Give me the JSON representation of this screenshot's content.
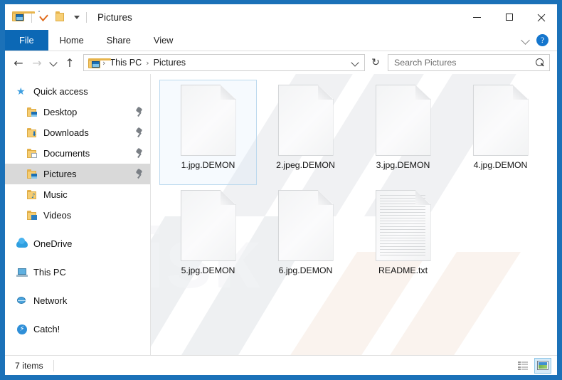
{
  "window": {
    "title": "Pictures",
    "quick_access_toolbar": [
      {
        "icon": "pictures-folder-icon",
        "name": "pictures-folder"
      },
      {
        "icon": "properties-icon",
        "name": "properties"
      },
      {
        "icon": "new-folder-icon",
        "name": "new-folder"
      },
      {
        "icon": "customize-caret-icon",
        "name": "customize-quick-access-toolbar"
      }
    ],
    "controls": {
      "minimize": "—",
      "maximize": "□",
      "close": "✕"
    }
  },
  "ribbon": {
    "tabs": [
      {
        "label": "File",
        "active": true
      },
      {
        "label": "Home",
        "active": false
      },
      {
        "label": "Share",
        "active": false
      },
      {
        "label": "View",
        "active": false
      }
    ],
    "help_label": "?"
  },
  "address_bar": {
    "back_glyph": "←",
    "forward_glyph": "→",
    "up_glyph": "↑",
    "refresh_glyph": "↻",
    "breadcrumbs": [
      "This PC",
      "Pictures"
    ],
    "separator": "›"
  },
  "search": {
    "placeholder": "Search Pictures",
    "value": ""
  },
  "sidebar": {
    "items": [
      {
        "label": "Quick access",
        "icon": "star-icon",
        "indent": false,
        "pinned": false,
        "selected": false
      },
      {
        "label": "Desktop",
        "icon": "desktop-folder-icon",
        "indent": true,
        "pinned": true,
        "selected": false
      },
      {
        "label": "Downloads",
        "icon": "downloads-folder-icon",
        "indent": true,
        "pinned": true,
        "selected": false
      },
      {
        "label": "Documents",
        "icon": "documents-folder-icon",
        "indent": true,
        "pinned": true,
        "selected": false
      },
      {
        "label": "Pictures",
        "icon": "pictures-folder-icon",
        "indent": true,
        "pinned": true,
        "selected": true
      },
      {
        "label": "Music",
        "icon": "music-folder-icon",
        "indent": true,
        "pinned": false,
        "selected": false
      },
      {
        "label": "Videos",
        "icon": "videos-folder-icon",
        "indent": true,
        "pinned": false,
        "selected": false
      },
      {
        "label": "OneDrive",
        "icon": "cloud-icon",
        "indent": false,
        "pinned": false,
        "selected": false
      },
      {
        "label": "This PC",
        "icon": "computer-icon",
        "indent": false,
        "pinned": false,
        "selected": false
      },
      {
        "label": "Network",
        "icon": "network-icon",
        "indent": false,
        "pinned": false,
        "selected": false
      },
      {
        "label": "Catch!",
        "icon": "catch-lightning-icon",
        "indent": false,
        "pinned": false,
        "selected": false
      }
    ]
  },
  "files": [
    {
      "name": "1.jpg.DEMON",
      "type": "blank-document",
      "selected": true
    },
    {
      "name": "2.jpeg.DEMON",
      "type": "blank-document",
      "selected": false
    },
    {
      "name": "3.jpg.DEMON",
      "type": "blank-document",
      "selected": false
    },
    {
      "name": "4.jpg.DEMON",
      "type": "blank-document",
      "selected": false
    },
    {
      "name": "5.jpg.DEMON",
      "type": "blank-document",
      "selected": false
    },
    {
      "name": "6.jpg.DEMON",
      "type": "blank-document",
      "selected": false
    },
    {
      "name": "README.txt",
      "type": "text-document",
      "selected": false
    }
  ],
  "status_bar": {
    "item_count": "7 items",
    "views": [
      {
        "name": "details-view",
        "active": false
      },
      {
        "name": "large-icons-view",
        "active": true
      }
    ]
  },
  "watermark": {
    "text": "pcrisk.com"
  },
  "colors": {
    "window_frame": "#1b71b8",
    "file_tab": "#0c68b5",
    "selection": "#d9d9d9",
    "tile_selection_border": "#bcd9ee",
    "help_button": "#1576cd"
  }
}
